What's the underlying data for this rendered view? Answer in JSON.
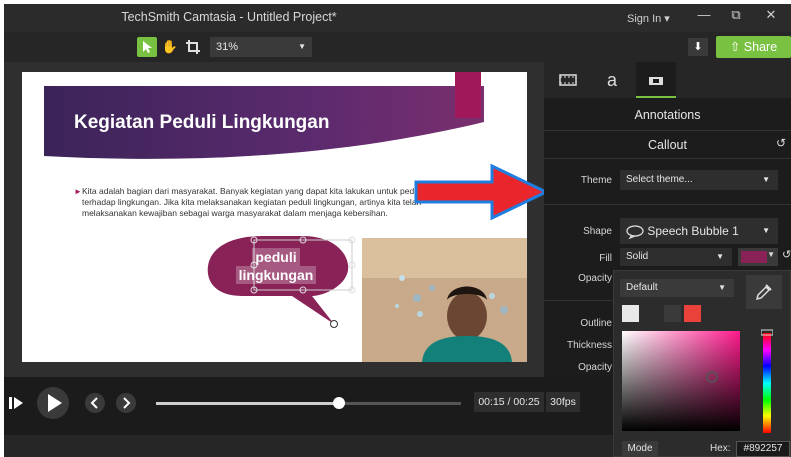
{
  "app": {
    "title": "TechSmith Camtasia - Untitled Project*",
    "signin": "Sign In ▾",
    "minimize": "—",
    "restore": "⧉",
    "close": "✕"
  },
  "toolbar": {
    "zoom": "31%",
    "download": "⬇",
    "share": "Share",
    "share_icon": "⇧"
  },
  "slide": {
    "title": "Kegiatan Peduli Lingkungan",
    "body": "Kita adalah bagian dari masyarakat. Banyak kegiatan yang dapat kita lakukan untuk peduli terhadap lingkungan. Jika kita melaksanakan kegiatan peduli lingkungan, artinya kita telah melaksanakan kewajiban sebagai warga masyarakat dalam menjaga kebersihan.",
    "bubble_line1": "peduli",
    "bubble_line2": "lingkungan",
    "accent_color": "#a0185a",
    "banner_color": "#5b2a6e"
  },
  "panel": {
    "header": "Annotations",
    "subheader": "Callout",
    "theme_label": "Theme",
    "theme_value": "Select theme...",
    "shape_label": "Shape",
    "shape_value": "Speech Bubble 1",
    "fill_label": "Fill",
    "fill_value": "Solid",
    "opacity_label": "Opacity",
    "outline_label": "Outline",
    "thickness_label": "Thickness",
    "opacity2_label": "Opacity",
    "fill_color": "#892257"
  },
  "picker": {
    "preset": "Default",
    "mode": "Mode",
    "hex_label": "Hex:",
    "hex_value": "#892257",
    "swatches": [
      "#e8e8e8",
      "#3a3a3a",
      "#e8423a"
    ]
  },
  "timeline": {
    "timecode": "00:15 / 00:25",
    "fps": "30fps",
    "progress": 0.6
  },
  "icons": {
    "pointer": "pointer-icon",
    "hand": "hand-icon",
    "crop": "crop-icon",
    "media": "media-icon",
    "annotation": "annotation-icon",
    "transition": "transition-icon",
    "reset": "reset-icon",
    "eyedropper": "eyedropper-icon"
  }
}
